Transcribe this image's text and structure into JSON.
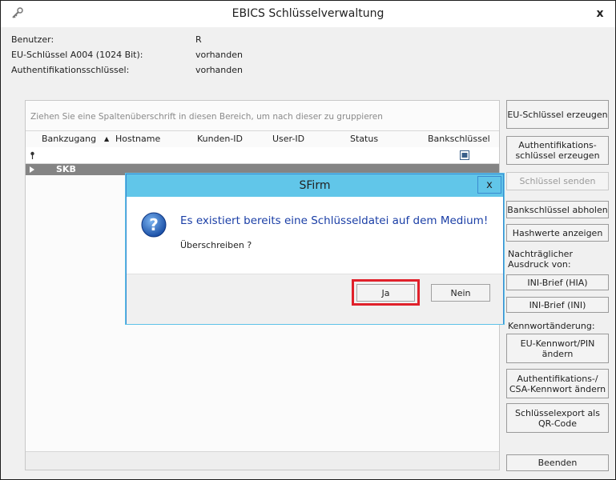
{
  "window": {
    "title": "EBICS Schlüsselverwaltung",
    "close_glyph": "x"
  },
  "info": [
    {
      "label": "Benutzer:",
      "value": "R"
    },
    {
      "label": "EU-Schlüssel A004 (1024 Bit):",
      "value": "vorhanden"
    },
    {
      "label": "Authentifikationsschlüssel:",
      "value": "vorhanden"
    }
  ],
  "grid": {
    "group_hint": "Ziehen Sie eine Spaltenüberschrift in diesen Bereich, um nach dieser zu gruppieren",
    "columns": [
      "Bankzugang",
      "Hostname",
      "Kunden-ID",
      "User-ID",
      "Status",
      "Bankschlüssel"
    ],
    "sort_indicator": "▲",
    "rows": [
      {
        "bankzugang": "SKB"
      }
    ]
  },
  "side_buttons": {
    "eu_key": "EU-Schlüssel erzeugen",
    "auth_key": "Authentifikations-schlüssel erzeugen",
    "send_keys": "Schlüssel senden",
    "fetch_bank_keys": "Bankschlüssel abholen",
    "show_hashes": "Hashwerte anzeigen",
    "reprint_label_1": "Nachträglicher",
    "reprint_label_2": "Ausdruck von:",
    "ini_hia": "INI-Brief (HIA)",
    "ini_ini": "INI-Brief (INI)",
    "password_change_label": "Kennwortänderung:",
    "eu_password": "EU-Kennwort/PIN ändern",
    "auth_csa_password": "Authentifikations-/ CSA-Kennwort ändern",
    "qr_export": "Schlüsselexport als QR-Code",
    "close": "Beenden"
  },
  "dialog": {
    "title": "SFirm",
    "close_glyph": "x",
    "message": "Es existiert bereits eine Schlüsseldatei auf dem Medium!",
    "question": "Überschreiben ?",
    "yes": "Ja",
    "no": "Nein"
  },
  "colors": {
    "dialog_title": "#61c6e9",
    "message_text": "#1a3ea6",
    "highlight": "#e0212b",
    "selected_row": "#848484"
  }
}
